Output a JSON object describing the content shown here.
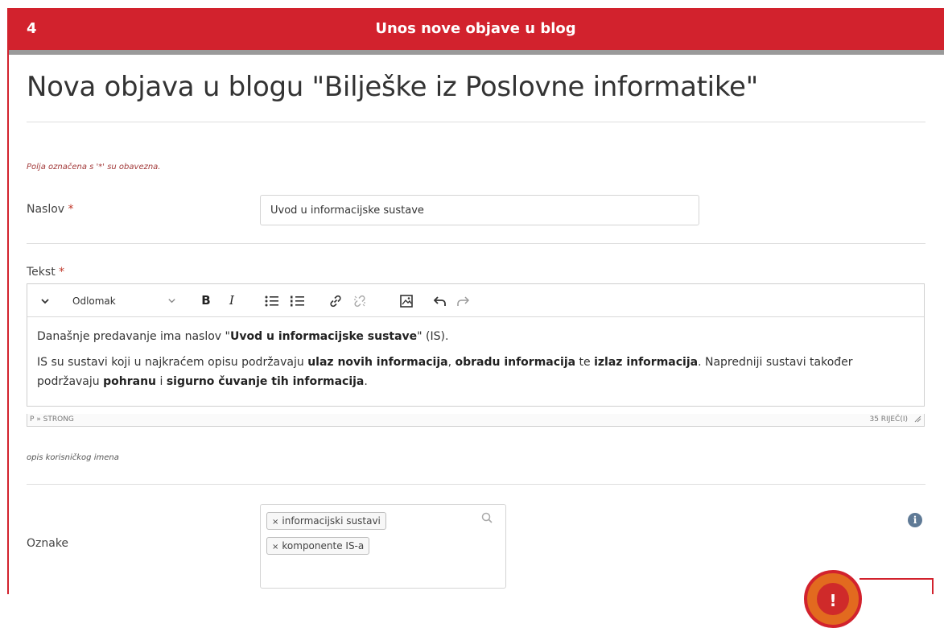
{
  "banner": {
    "number": "4",
    "title": "Unos nove objave u blog"
  },
  "page": {
    "title": "Nova objava u blogu \"Bilješke iz Poslovne informatike\""
  },
  "form": {
    "required_note": "Polja označena s '*' su obavezna.",
    "naslov_label": "Naslov",
    "naslov_value": "Uvod u informacijske sustave",
    "tekst_label": "Tekst",
    "required_mark": "*",
    "username_description": "opis korisničkog imena",
    "oznake_label": "Oznake"
  },
  "editor": {
    "block_format": "Odlomak",
    "content": {
      "p1": {
        "before": "Današnje predavanje ima naslov \"",
        "bold": "Uvod u informacijske sustave",
        "after": "\" (IS)."
      },
      "p2": {
        "s1": "IS su sustavi koji u najkraćem opisu podržavaju ",
        "b1": "ulaz novih informacija",
        "s2": ", ",
        "b2": "obradu informacija",
        "s3": " te ",
        "b3": "izlaz informacija",
        "s4": ". Napredniji sustavi također podržavaju ",
        "b4": "pohranu",
        "s5": " i ",
        "b5": "sigurno čuvanje tih informacija",
        "s6": "."
      }
    },
    "status_path": "P » STRONG",
    "word_count": "35 RIJEČ(I)"
  },
  "tags": [
    {
      "label": "informacijski sustavi",
      "remove": "×"
    },
    {
      "label": "komponente IS-a",
      "remove": "×"
    }
  ],
  "icons": {
    "collapse": "chevron-down-icon",
    "bold": "bold-icon",
    "italic": "italic-icon",
    "bullet_list": "bullet-list-icon",
    "numbered_list": "numbered-list-icon",
    "link": "link-icon",
    "unlink": "unlink-icon",
    "image": "image-icon",
    "undo": "undo-icon",
    "redo": "redo-icon",
    "search": "search-icon",
    "info": "info-icon"
  },
  "colors": {
    "banner": "#d2222d",
    "required": "#c0392b",
    "info": "#5f7a96"
  },
  "ui": {
    "bold_glyph": "B",
    "italic_glyph": "I",
    "info_glyph": "i",
    "warn_glyph": "!"
  }
}
